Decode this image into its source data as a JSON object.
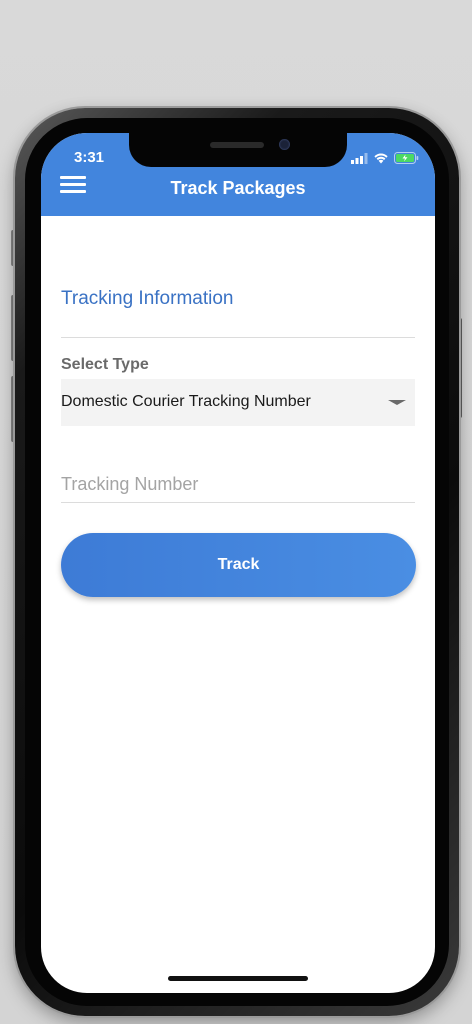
{
  "status_bar": {
    "time": "3:31",
    "signal_icon": "cellular-signal-icon",
    "wifi_icon": "wifi-icon",
    "battery_icon": "battery-charging-icon"
  },
  "header": {
    "title": "Track Packages",
    "menu_icon": "hamburger-menu-icon",
    "background_color": "#4285dd"
  },
  "form": {
    "section_title": "Tracking Information",
    "select_label": "Select Type",
    "select_value": "Domestic Courier Tracking Number",
    "tracking_placeholder": "Tracking Number",
    "tracking_value": "",
    "track_button_label": "Track"
  },
  "colors": {
    "accent": "#3a72c4",
    "button": "#4a8ee3"
  }
}
